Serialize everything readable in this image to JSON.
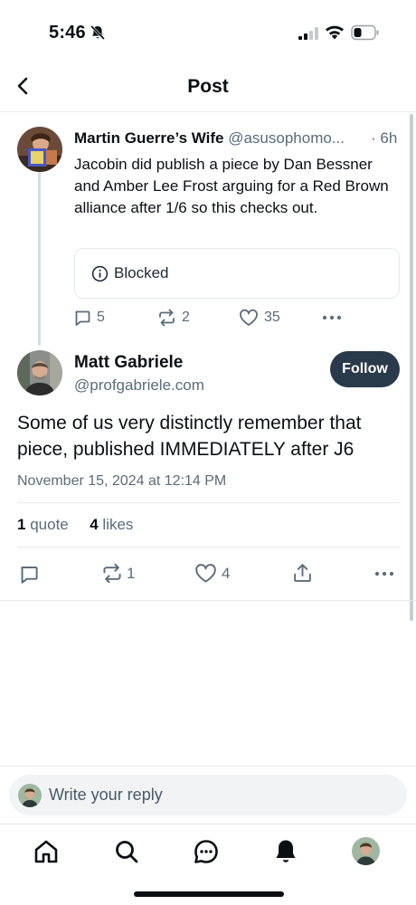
{
  "status_bar": {
    "time": "5:46"
  },
  "header": {
    "title": "Post"
  },
  "parent_post": {
    "author_name": "Martin Guerre’s Wife",
    "author_handle": "@asusophomo...",
    "time_ago": "· 6h",
    "text": "Jacobin did publish a piece by Dan Bessner and Amber Lee Frost arguing for a Red Brown alliance after 1/6 so this checks out.",
    "embed_label": "Blocked",
    "replies": "5",
    "reposts": "2",
    "likes": "35"
  },
  "main_post": {
    "author_name": "Matt Gabriele",
    "author_handle": "@profgabriele.com",
    "follow_label": "Follow",
    "text": "Some of us very distinctly remember that piece, published IMMEDIATELY after J6",
    "date": "November 15, 2024 at 12:14 PM",
    "quote_count": "1",
    "quote_label": "quote",
    "like_count": "4",
    "like_label": "likes",
    "reposts": "1",
    "likes": "4"
  },
  "reply": {
    "placeholder": "Write your reply"
  },
  "icons": {
    "status": [
      "bell-muted-icon",
      "signal-icon",
      "wifi-icon",
      "battery-icon"
    ],
    "nav": [
      "home-icon",
      "search-icon",
      "chat-icon",
      "bell-icon",
      "profile-avatar"
    ]
  },
  "colors": {
    "text": "#0b0f14",
    "muted": "#5b6b7a",
    "follow_bg": "#2a3a4b",
    "reply_bg": "#f1f3f5"
  }
}
